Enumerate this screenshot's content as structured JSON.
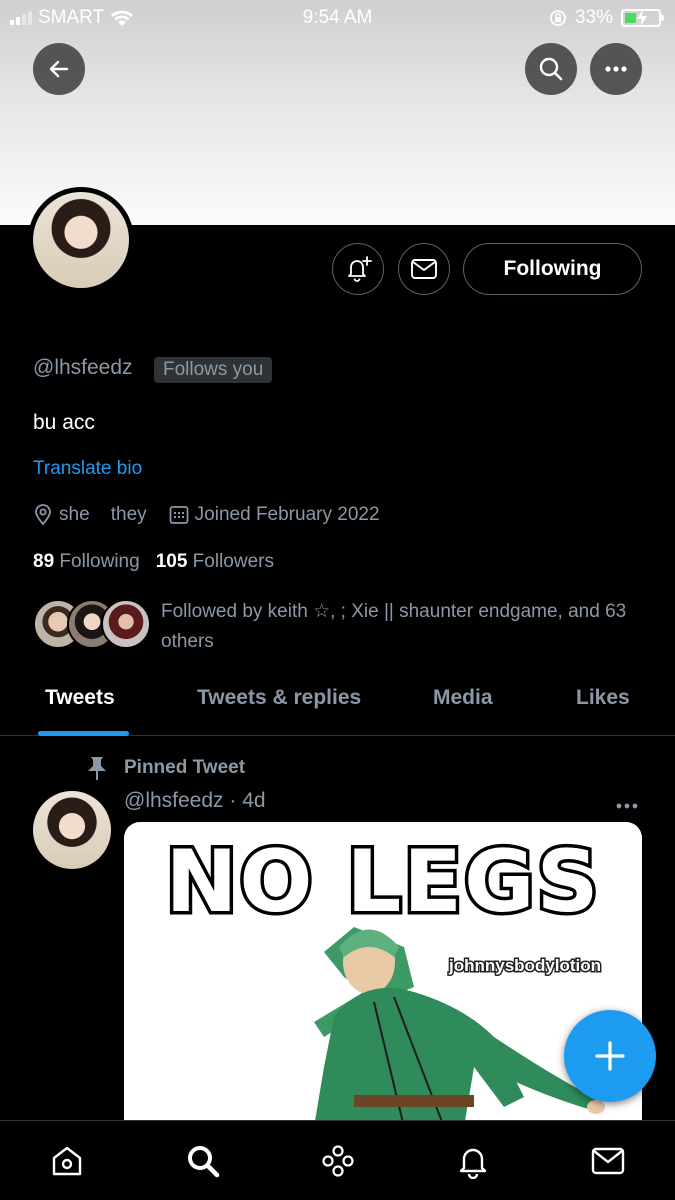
{
  "status_bar": {
    "carrier": "SMART",
    "time": "9:54 AM",
    "battery_percent": "33%",
    "battery_level": 0.33
  },
  "header": {
    "back_icon": "arrow-left-icon",
    "search_icon": "search-icon",
    "more_icon": "more-horizontal-icon"
  },
  "profile": {
    "handle": "@lhsfeedz",
    "follows_you": "Follows you",
    "bio": "bu acc",
    "translate_bio": "Translate bio",
    "location": "she    they",
    "joined": "Joined February 2022",
    "following_count": "89",
    "following_label": "Following",
    "followers_count": "105",
    "followers_label": "Followers",
    "followed_by": "Followed by keith ☆, ; Xie || shaunter endgame, and 63 others"
  },
  "actions": {
    "following_button": "Following"
  },
  "tabs": [
    {
      "label": "Tweets",
      "active": true
    },
    {
      "label": "Tweets & replies",
      "active": false
    },
    {
      "label": "Media",
      "active": false
    },
    {
      "label": "Likes",
      "active": false
    }
  ],
  "pinned_tweet": {
    "pinned_label": "Pinned Tweet",
    "meta": "@lhsfeedz · 4d",
    "media_caption": "NO LEGS",
    "media_watermark": "johnnysbodylotion"
  },
  "bottom_nav": [
    "home-icon",
    "search-icon",
    "spaces-icon",
    "notifications-icon",
    "messages-icon"
  ],
  "colors": {
    "accent": "#1d9bf0",
    "secondary_text": "#8b98a5",
    "background": "#000000",
    "battery_fill": "#4cd964"
  }
}
